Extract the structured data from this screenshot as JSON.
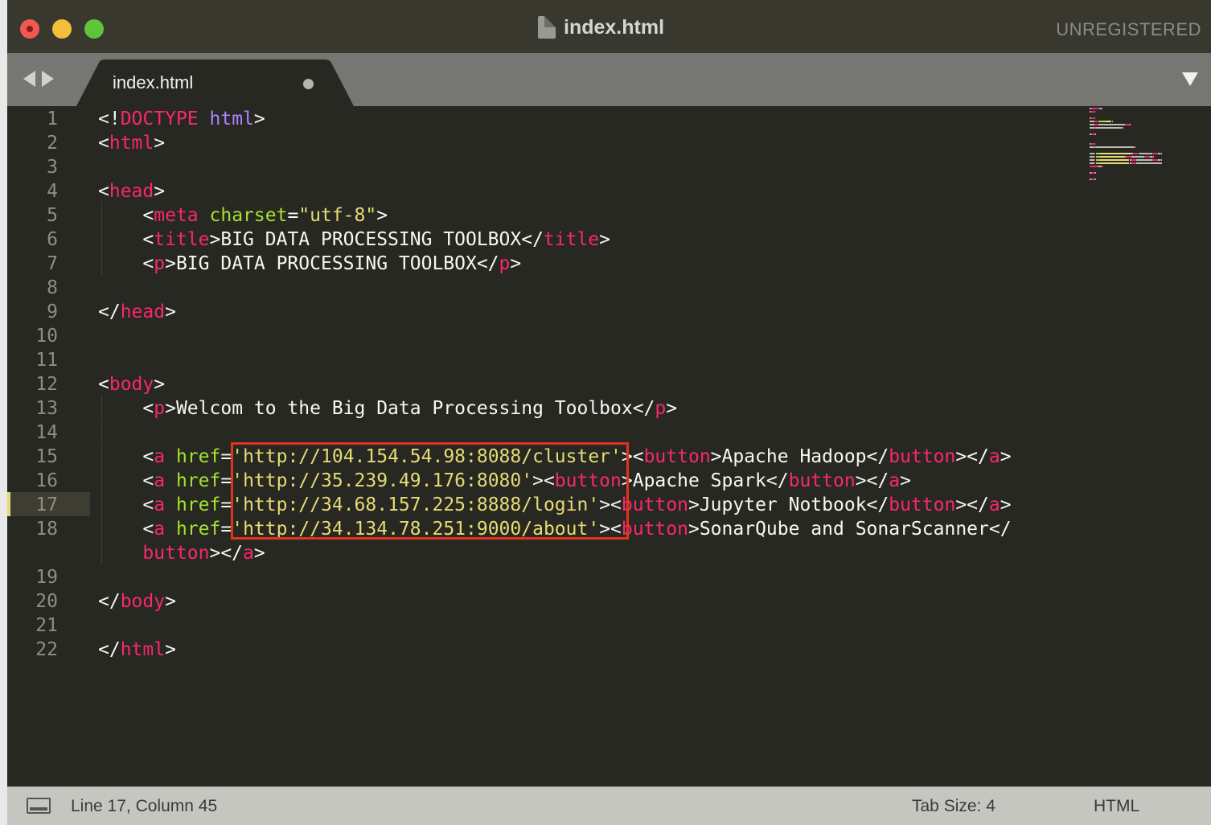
{
  "window": {
    "title": "index.html",
    "registration": "UNREGISTERED"
  },
  "tab": {
    "label": "index.html",
    "modified": true
  },
  "editor": {
    "current_line": 17,
    "line_numbers": [
      "1",
      "2",
      "3",
      "4",
      "5",
      "6",
      "7",
      "8",
      "9",
      "10",
      "11",
      "12",
      "13",
      "14",
      "15",
      "16",
      "17",
      "18",
      "",
      "19",
      "20",
      "21",
      "22"
    ],
    "lines": [
      [
        {
          "t": "w",
          "v": "<!"
        },
        {
          "t": "t",
          "v": "DOCTYPE"
        },
        {
          "t": "w",
          "v": " "
        },
        {
          "t": "k",
          "v": "html"
        },
        {
          "t": "w",
          "v": ">"
        }
      ],
      [
        {
          "t": "w",
          "v": "<"
        },
        {
          "t": "t",
          "v": "html"
        },
        {
          "t": "w",
          "v": ">"
        }
      ],
      [],
      [
        {
          "t": "w",
          "v": "<"
        },
        {
          "t": "t",
          "v": "head"
        },
        {
          "t": "w",
          "v": ">"
        }
      ],
      [
        {
          "t": "w",
          "v": "    <"
        },
        {
          "t": "t",
          "v": "meta"
        },
        {
          "t": "w",
          "v": " "
        },
        {
          "t": "a",
          "v": "charset"
        },
        {
          "t": "w",
          "v": "="
        },
        {
          "t": "s",
          "v": "\"utf-8\""
        },
        {
          "t": "w",
          "v": ">"
        }
      ],
      [
        {
          "t": "w",
          "v": "    <"
        },
        {
          "t": "t",
          "v": "title"
        },
        {
          "t": "w",
          "v": ">BIG DATA PROCESSING TOOLBOX</"
        },
        {
          "t": "t",
          "v": "title"
        },
        {
          "t": "w",
          "v": ">"
        }
      ],
      [
        {
          "t": "w",
          "v": "    <"
        },
        {
          "t": "t",
          "v": "p"
        },
        {
          "t": "w",
          "v": ">BIG DATA PROCESSING TOOLBOX</"
        },
        {
          "t": "t",
          "v": "p"
        },
        {
          "t": "w",
          "v": ">"
        }
      ],
      [],
      [
        {
          "t": "w",
          "v": "</"
        },
        {
          "t": "t",
          "v": "head"
        },
        {
          "t": "w",
          "v": ">"
        }
      ],
      [],
      [],
      [
        {
          "t": "w",
          "v": "<"
        },
        {
          "t": "t",
          "v": "body"
        },
        {
          "t": "w",
          "v": ">"
        }
      ],
      [
        {
          "t": "w",
          "v": "    <"
        },
        {
          "t": "t",
          "v": "p"
        },
        {
          "t": "w",
          "v": ">Welcom to the Big Data Processing Toolbox</"
        },
        {
          "t": "t",
          "v": "p"
        },
        {
          "t": "w",
          "v": ">"
        }
      ],
      [],
      [
        {
          "t": "w",
          "v": "    <"
        },
        {
          "t": "t",
          "v": "a"
        },
        {
          "t": "w",
          "v": " "
        },
        {
          "t": "a",
          "v": "href"
        },
        {
          "t": "w",
          "v": "="
        },
        {
          "t": "s",
          "v": "'http://104.154.54.98:8088/cluster'"
        },
        {
          "t": "w",
          "v": "><"
        },
        {
          "t": "t",
          "v": "button"
        },
        {
          "t": "w",
          "v": ">Apache Hadoop</"
        },
        {
          "t": "t",
          "v": "button"
        },
        {
          "t": "w",
          "v": "></"
        },
        {
          "t": "t",
          "v": "a"
        },
        {
          "t": "w",
          "v": ">"
        }
      ],
      [
        {
          "t": "w",
          "v": "    <"
        },
        {
          "t": "t",
          "v": "a"
        },
        {
          "t": "w",
          "v": " "
        },
        {
          "t": "a",
          "v": "href"
        },
        {
          "t": "w",
          "v": "="
        },
        {
          "t": "s",
          "v": "'http://35.239.49.176:8080'"
        },
        {
          "t": "w",
          "v": "><"
        },
        {
          "t": "t",
          "v": "button"
        },
        {
          "t": "w",
          "v": ">Apache Spark</"
        },
        {
          "t": "t",
          "v": "button"
        },
        {
          "t": "w",
          "v": "></"
        },
        {
          "t": "t",
          "v": "a"
        },
        {
          "t": "w",
          "v": ">"
        }
      ],
      [
        {
          "t": "w",
          "v": "    <"
        },
        {
          "t": "t",
          "v": "a"
        },
        {
          "t": "w",
          "v": " "
        },
        {
          "t": "a",
          "v": "href"
        },
        {
          "t": "w",
          "v": "="
        },
        {
          "t": "s",
          "v": "'http://34.68.157.225:8888/login'"
        },
        {
          "t": "w",
          "v": "><"
        },
        {
          "t": "t",
          "v": "button"
        },
        {
          "t": "w",
          "v": ">Jupyter Notbook</"
        },
        {
          "t": "t",
          "v": "button"
        },
        {
          "t": "w",
          "v": "></"
        },
        {
          "t": "t",
          "v": "a"
        },
        {
          "t": "w",
          "v": ">"
        }
      ],
      [
        {
          "t": "w",
          "v": "    <"
        },
        {
          "t": "t",
          "v": "a"
        },
        {
          "t": "w",
          "v": " "
        },
        {
          "t": "a",
          "v": "href"
        },
        {
          "t": "w",
          "v": "="
        },
        {
          "t": "s",
          "v": "'http://34.134.78.251:9000/about'"
        },
        {
          "t": "w",
          "v": "><"
        },
        {
          "t": "t",
          "v": "button"
        },
        {
          "t": "w",
          "v": ">SonarQube and SonarScanner</"
        }
      ],
      [
        {
          "t": "t",
          "v": "    button"
        },
        {
          "t": "w",
          "v": "></"
        },
        {
          "t": "t",
          "v": "a"
        },
        {
          "t": "w",
          "v": ">"
        }
      ],
      [],
      [
        {
          "t": "w",
          "v": "</"
        },
        {
          "t": "t",
          "v": "body"
        },
        {
          "t": "w",
          "v": ">"
        }
      ],
      [],
      [
        {
          "t": "w",
          "v": "</"
        },
        {
          "t": "t",
          "v": "html"
        },
        {
          "t": "w",
          "v": ">"
        }
      ]
    ]
  },
  "status": {
    "position": "Line 17, Column 45",
    "tab_size": "Tab Size: 4",
    "syntax": "HTML"
  },
  "colors": {
    "tag": "#f92672",
    "attribute": "#a6e22e",
    "string": "#e6db74",
    "keyword": "#ae81ff",
    "text": "#f8f8f2",
    "background": "#272822",
    "highlight_box": "#e0341e"
  },
  "icons": [
    "close-button-icon",
    "minimize-button-icon",
    "maximize-button-icon",
    "document-icon",
    "nav-back-icon",
    "nav-forward-icon",
    "tab-modified-dot-icon",
    "tab-dropdown-icon",
    "console-panel-icon"
  ]
}
